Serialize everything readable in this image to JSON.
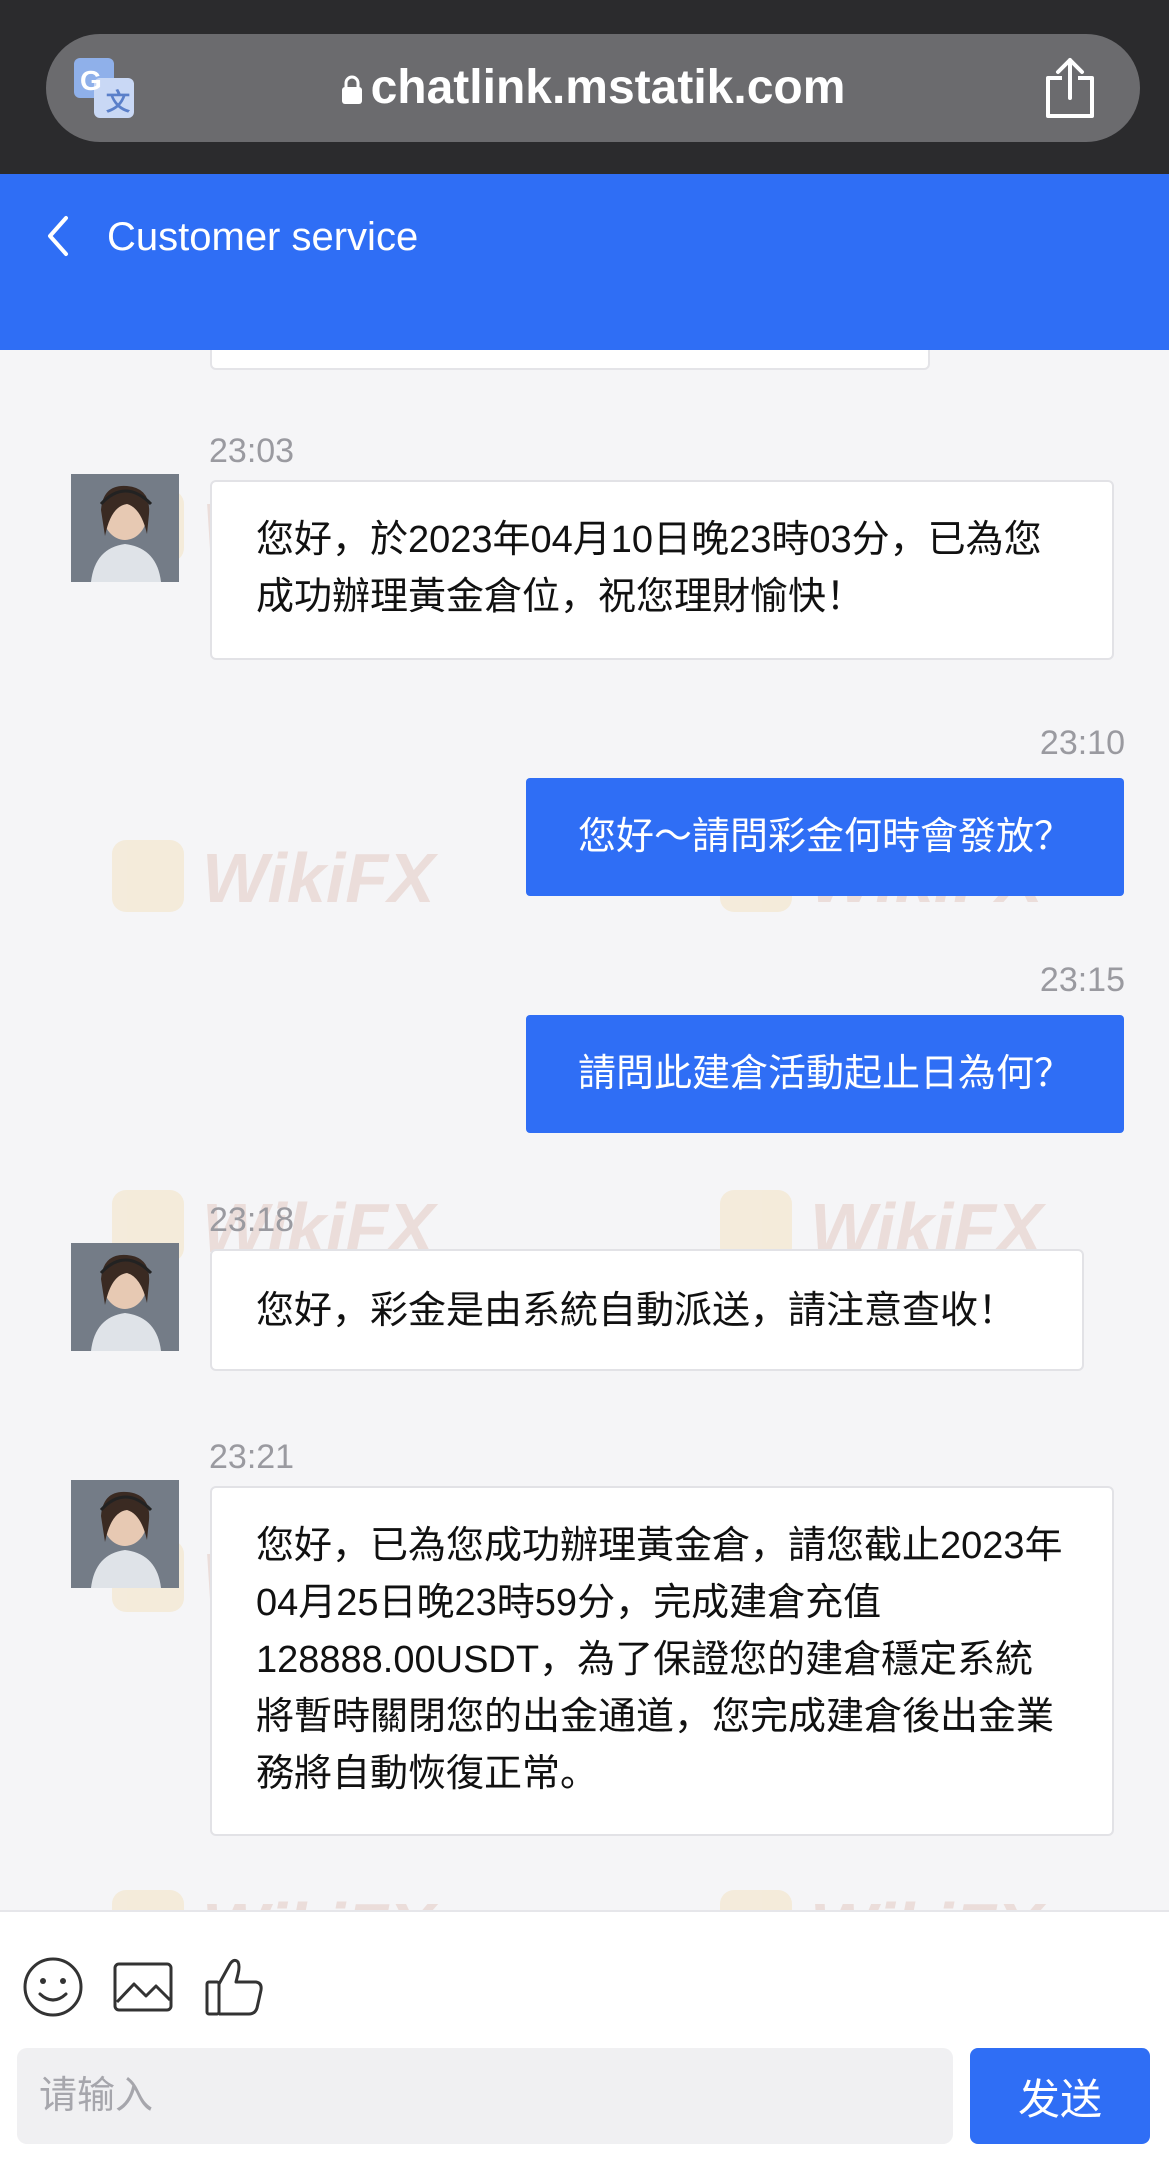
{
  "browser": {
    "url": "chatlink.mstatik.com",
    "icons": {
      "translate": "translate-icon",
      "lock": "lock-icon",
      "share": "share-icon"
    }
  },
  "header": {
    "title": "Customer service",
    "back_icon": "chevron-left-icon",
    "color": "#2f6ef5"
  },
  "messages": [
    {
      "direction": "incoming",
      "time": "23:03",
      "text": "您好，於2023年04月10日晚23時03分，已為您成功辦理黃金倉位，祝您理財愉快！"
    },
    {
      "direction": "outgoing",
      "time": "23:10",
      "text": "您好～請問彩金何時會發放？"
    },
    {
      "direction": "outgoing",
      "time": "23:15",
      "text": "請問此建倉活動起止日為何？"
    },
    {
      "direction": "incoming",
      "time": "23:18",
      "text": "您好，彩金是由系統自動派送，請注意查收！"
    },
    {
      "direction": "incoming",
      "time": "23:21",
      "text": "您好，已為您成功辦理黃金倉，請您截止2023年04月25日晚23時59分，完成建倉充值128888.00USDT，為了保證您的建倉穩定系統將暫時關閉您的出金通道，您完成建倉後出金業務將自動恢復正常。"
    }
  ],
  "watermark": "WikiFX",
  "composer": {
    "tools": [
      "emoji-icon",
      "image-icon",
      "thumbs-up-icon"
    ],
    "placeholder": "请输入",
    "value": "",
    "send_label": "发送"
  },
  "colors": {
    "accent": "#2f6ef5",
    "background": "#f5f5f7"
  }
}
